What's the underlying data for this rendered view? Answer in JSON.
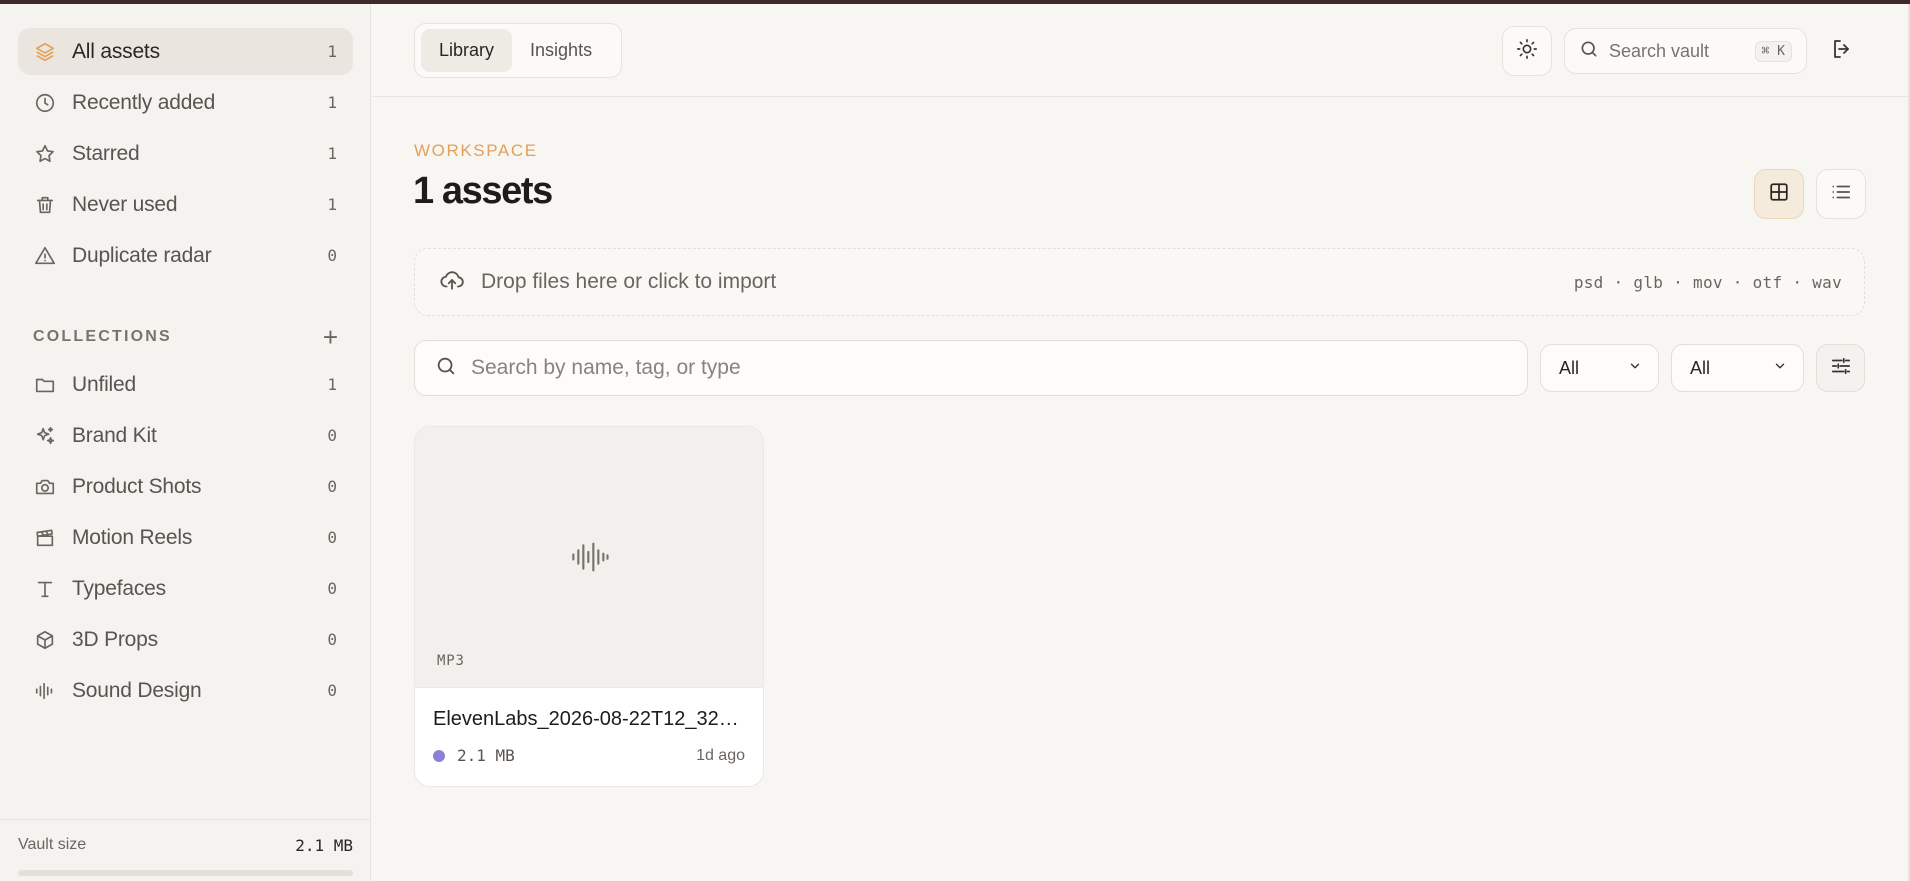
{
  "sidebar": {
    "nav": [
      {
        "label": "All assets",
        "count": "1",
        "icon": "layers-icon",
        "active": true
      },
      {
        "label": "Recently added",
        "count": "1",
        "icon": "clock-icon"
      },
      {
        "label": "Starred",
        "count": "1",
        "icon": "star-icon"
      },
      {
        "label": "Never used",
        "count": "1",
        "icon": "trash-icon"
      },
      {
        "label": "Duplicate radar",
        "count": "0",
        "icon": "warning-icon"
      }
    ],
    "collections_title": "COLLECTIONS",
    "add_label": "+",
    "collections": [
      {
        "label": "Unfiled",
        "count": "1",
        "icon": "folder-icon"
      },
      {
        "label": "Brand Kit",
        "count": "0",
        "icon": "sparkles-icon"
      },
      {
        "label": "Product Shots",
        "count": "0",
        "icon": "camera-icon"
      },
      {
        "label": "Motion Reels",
        "count": "0",
        "icon": "clapperboard-icon"
      },
      {
        "label": "Typefaces",
        "count": "0",
        "icon": "type-icon"
      },
      {
        "label": "3D Props",
        "count": "0",
        "icon": "cube-icon"
      },
      {
        "label": "Sound Design",
        "count": "0",
        "icon": "audio-wave-icon"
      }
    ],
    "footer": {
      "label": "Vault size",
      "value": "2.1 MB"
    }
  },
  "header": {
    "tabs": [
      {
        "label": "Library",
        "active": true
      },
      {
        "label": "Insights"
      }
    ],
    "search_placeholder": "Search vault",
    "shortcut": "⌘ K"
  },
  "main": {
    "eyebrow": "WORKSPACE",
    "title": "1 assets",
    "dropzone_text": "Drop files here or click to import",
    "dropzone_types": "psd · glb · mov · otf · wav",
    "search_placeholder": "Search by name, tag, or type",
    "filter_type": "All",
    "filter_collection": "All",
    "assets": [
      {
        "kind": "MP3",
        "name": "ElevenLabs_2026-08-22T12_32_4...",
        "size": "2.1 MB",
        "ago": "1d ago",
        "dot_color": "#8b82d8"
      }
    ]
  },
  "colors": {
    "accent": "#e3a158",
    "active_bg": "#eae6df"
  }
}
